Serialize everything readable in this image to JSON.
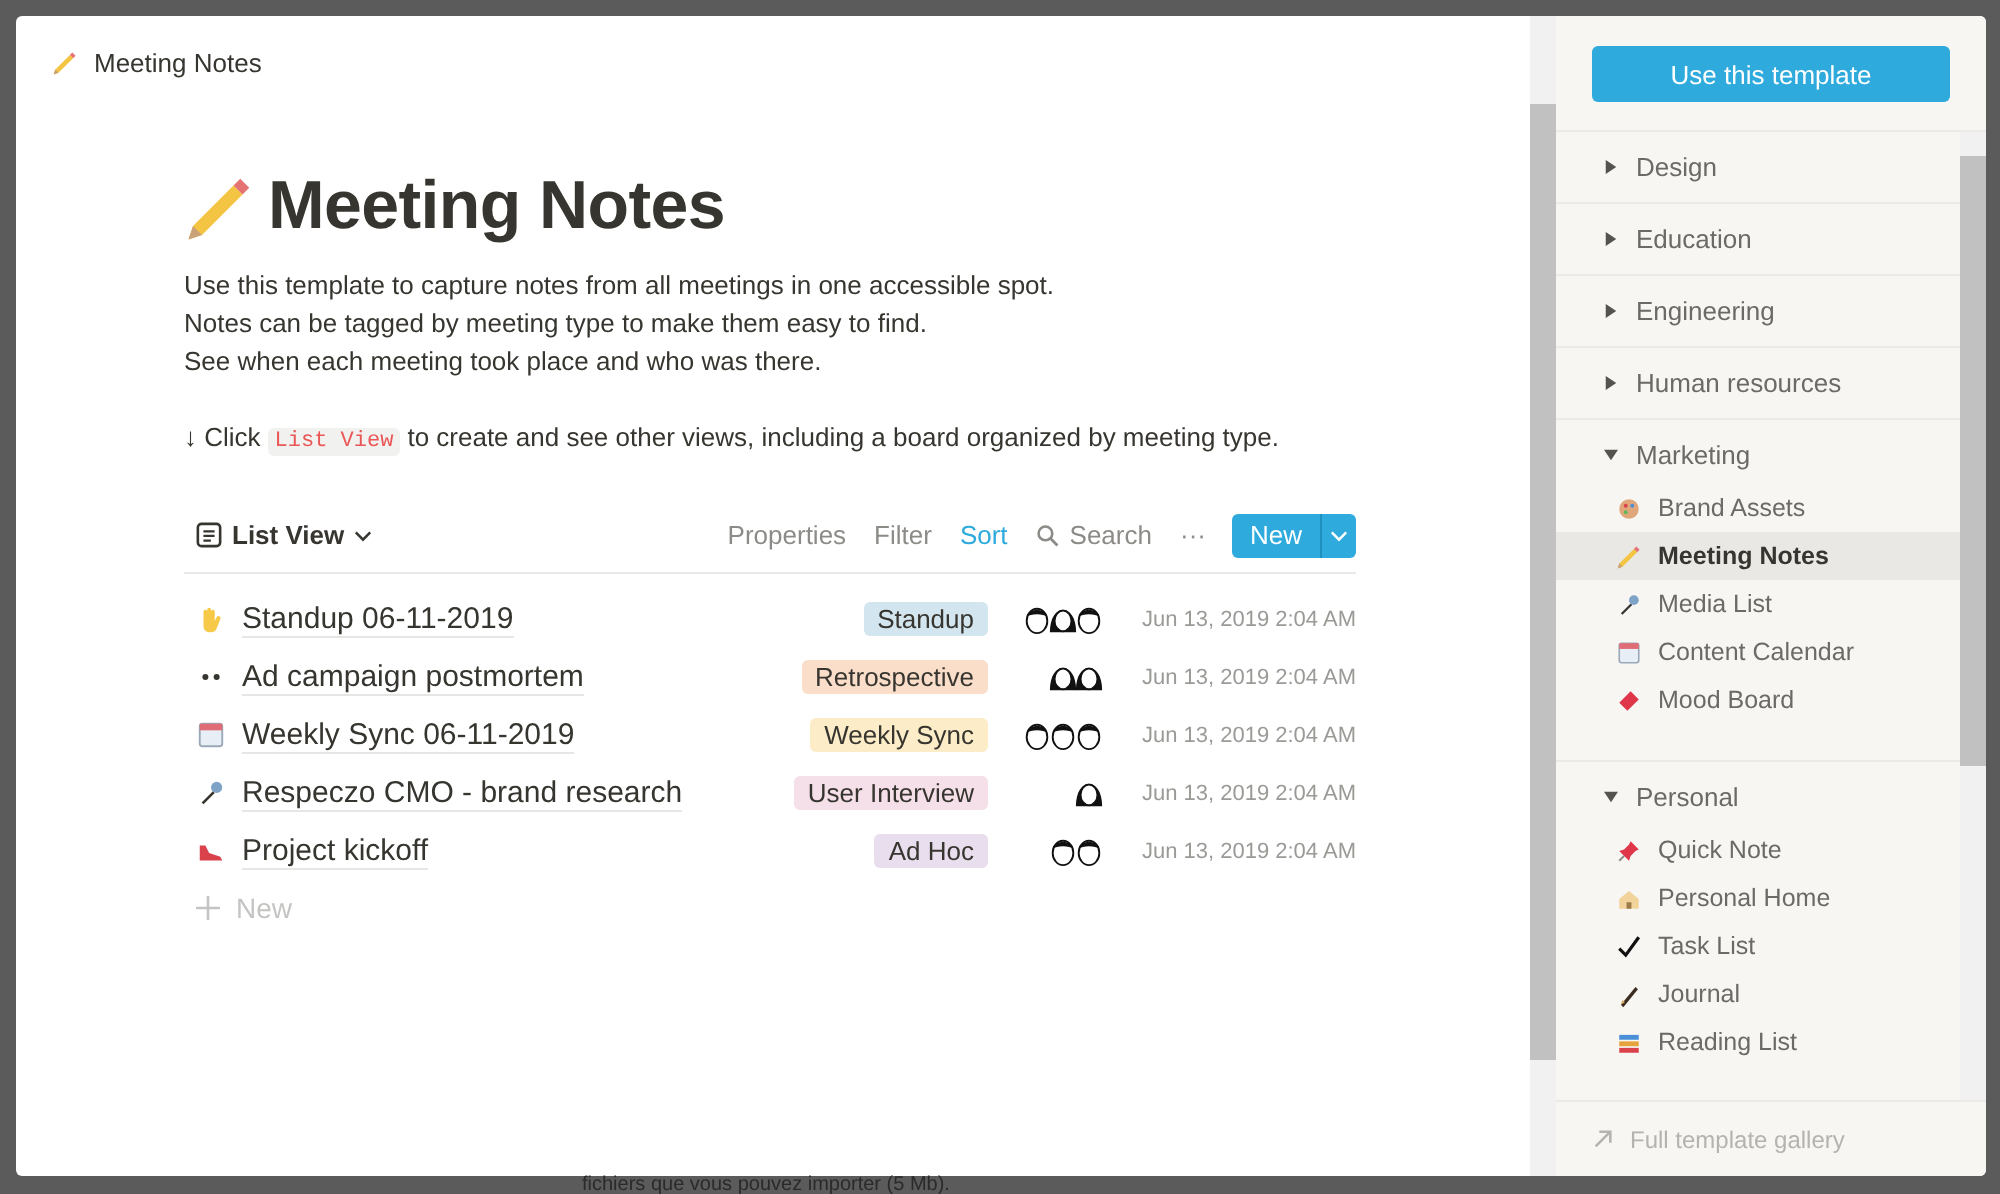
{
  "window": {
    "title": "Meeting Notes"
  },
  "page": {
    "title": "Meeting Notes",
    "description": [
      "Use this template to capture notes from all meetings in one accessible spot.",
      "Notes can be tagged by meeting type to make them easy to find.",
      "See when each meeting took place and who was there."
    ],
    "hint": {
      "before": "↓ Click",
      "code": "List View",
      "after": "to create and see other views, including a board organized by meeting type."
    }
  },
  "toolbar": {
    "view": "List View",
    "actions": [
      {
        "label": "Properties",
        "selected": false
      },
      {
        "label": "Filter",
        "selected": false
      },
      {
        "label": "Sort",
        "selected": true
      }
    ],
    "search": "Search",
    "more": "···",
    "new_button": "New"
  },
  "rows": [
    {
      "kind": "hand",
      "title": "Standup 06-11-2019",
      "tag": "Standup",
      "color": "#d3e5ef",
      "avatars": [
        {
          "kind": "man"
        },
        {
          "kind": "woman"
        },
        {
          "kind": "man"
        }
      ],
      "date": "Jun 13, 2019 2:04 AM"
    },
    {
      "kind": "eyes",
      "title": "Ad campaign postmortem",
      "tag": "Retrospective",
      "color": "#fadec9",
      "avatars": [
        {
          "kind": "woman"
        },
        {
          "kind": "woman"
        }
      ],
      "date": "Jun 13, 2019 2:04 AM"
    },
    {
      "kind": "calendar",
      "title": "Weekly Sync 06-11-2019",
      "tag": "Weekly Sync",
      "color": "#fdecc8",
      "avatars": [
        {
          "kind": "man"
        },
        {
          "kind": "man"
        },
        {
          "kind": "man"
        }
      ],
      "date": "Jun 13, 2019 2:04 AM"
    },
    {
      "kind": "microphone",
      "title": "Respeczo CMO - brand research",
      "tag": "User Interview",
      "color": "#f5e0e9",
      "avatars": [
        {
          "kind": "woman"
        }
      ],
      "date": "Jun 13, 2019 2:04 AM"
    },
    {
      "kind": "shoe",
      "title": "Project kickoff",
      "tag": "Ad Hoc",
      "color": "#e8deee",
      "avatars": [
        {
          "kind": "man"
        },
        {
          "kind": "man"
        }
      ],
      "date": "Jun 13, 2019 2:04 AM"
    }
  ],
  "add_row": "New",
  "sidebar": {
    "button": "Use this template",
    "categories": [
      {
        "label": "Design",
        "expanded": false
      },
      {
        "label": "Education",
        "expanded": false
      },
      {
        "label": "Engineering",
        "expanded": false
      },
      {
        "label": "Human resources",
        "expanded": false
      },
      {
        "label": "Marketing",
        "expanded": true,
        "children": [
          {
            "kind": "palette",
            "label": "Brand Assets",
            "selected": false
          },
          {
            "kind": "pencil",
            "label": "Meeting Notes",
            "selected": true
          },
          {
            "kind": "microphone",
            "label": "Media List",
            "selected": false
          },
          {
            "kind": "calendar",
            "label": "Content Calendar",
            "selected": false
          },
          {
            "kind": "ticket",
            "label": "Mood Board",
            "selected": false
          }
        ]
      },
      {
        "label": "Personal",
        "expanded": true,
        "children": [
          {
            "kind": "pin",
            "label": "Quick Note",
            "selected": false
          },
          {
            "kind": "house",
            "label": "Personal Home",
            "selected": false
          },
          {
            "kind": "check",
            "label": "Task List",
            "selected": false
          },
          {
            "kind": "pen",
            "label": "Journal",
            "selected": false
          },
          {
            "kind": "books",
            "label": "Reading List",
            "selected": false
          }
        ]
      }
    ],
    "footer": "Full template gallery"
  },
  "backdrop_text": "fichiers que vous pouvez importer (5 Mb)."
}
